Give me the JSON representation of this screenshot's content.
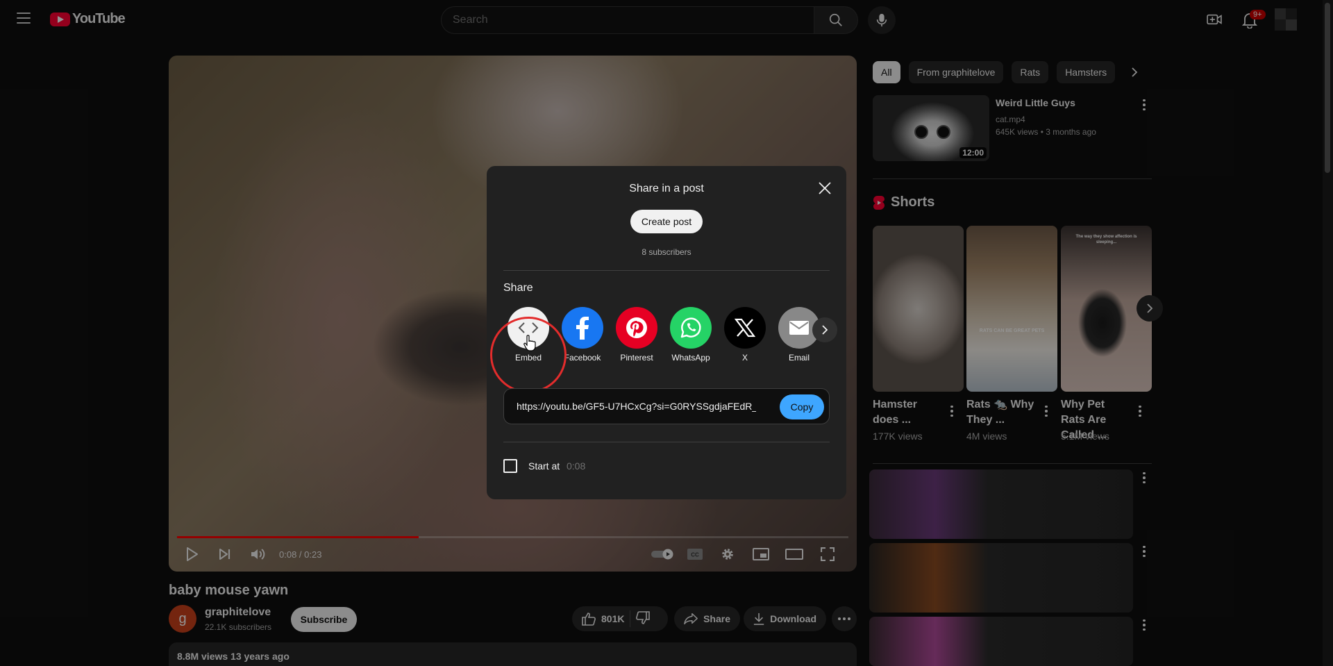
{
  "header": {
    "logo_text": "YouTube",
    "search_placeholder": "Search",
    "notif_count": "9+"
  },
  "player": {
    "time": "0:08 / 0:23",
    "progress_fraction": 0.36
  },
  "share_dialog": {
    "title": "Share in a post",
    "create_post": "Create post",
    "subscribers_note": "8 subscribers",
    "share_label": "Share",
    "targets": [
      {
        "label": "Embed",
        "icon": "embed-icon",
        "color": "#ffffff"
      },
      {
        "label": "Facebook",
        "icon": "facebook-icon",
        "color": "#1877f2"
      },
      {
        "label": "Pinterest",
        "icon": "pinterest-icon",
        "color": "#e60023"
      },
      {
        "label": "WhatsApp",
        "icon": "whatsapp-icon",
        "color": "#25d366"
      },
      {
        "label": "X",
        "icon": "x-icon",
        "color": "#000000"
      },
      {
        "label": "Email",
        "icon": "email-icon",
        "color": "#888888"
      }
    ],
    "url": "https://youtu.be/GF5-U7HCxCg?si=G0RYSSgdjaFEdR_",
    "copy": "Copy",
    "start_at_label": "Start at",
    "start_at_time": "0:08"
  },
  "video": {
    "title": "baby mouse yawn",
    "channel_initial": "g",
    "channel_name": "graphitelove",
    "channel_subs": "22.1K subscribers",
    "subscribe": "Subscribe",
    "likes": "801K",
    "share": "Share",
    "download": "Download",
    "description_meta": "8.8M views  13 years ago"
  },
  "sidebar": {
    "chips": [
      "All",
      "From graphitelove",
      "Rats",
      "Hamsters"
    ],
    "recommended": {
      "title": "Weird Little Guys",
      "channel": "cat.mp4",
      "meta": "645K views  • 3 months ago",
      "duration": "12:00"
    },
    "shorts_heading": "Shorts",
    "shorts": [
      {
        "title": "Hamster does ...",
        "views": "177K views",
        "overlay": ""
      },
      {
        "title": "Rats 🐀 Why They ...",
        "views": "4M views",
        "overlay": "RATS CAN BE GREAT PETS"
      },
      {
        "title": "Why Pet Rats Are Called ...",
        "views": "5.1M views",
        "overlay": "The way they show affection is sleeping..."
      }
    ]
  },
  "colors": {
    "accent_red": "#ff0000",
    "copy_blue": "#3ea6ff",
    "highlight_ring": "#e32c2c"
  }
}
